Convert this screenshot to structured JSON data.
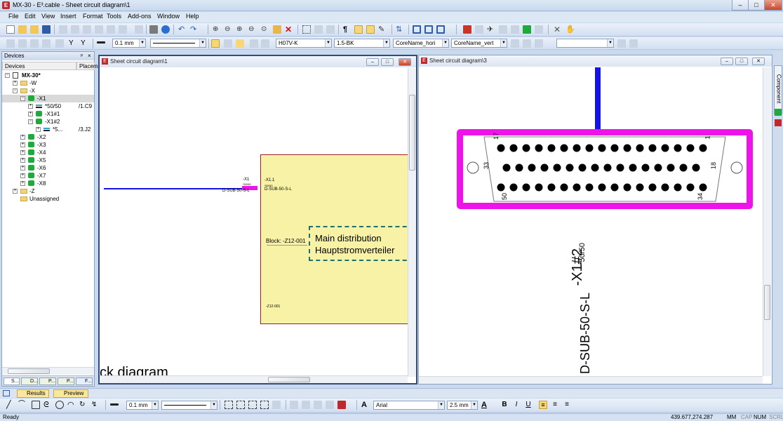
{
  "app": {
    "title": "MX-30 - E³.cable - Sheet circuit diagram\\1",
    "app_icon": "e3-icon",
    "window_buttons": [
      "–",
      "□",
      "✕"
    ]
  },
  "menu": [
    "File",
    "Edit",
    "View",
    "Insert",
    "Format",
    "Tools",
    "Add-ons",
    "Window",
    "Help"
  ],
  "toolbar2": {
    "line_width": "0.1 mm",
    "wire_type": "H07V-K",
    "wire_color": "1.5-BK",
    "core_name_h": "CoreName_hori",
    "core_name_v": "CoreName_vert"
  },
  "devices_panel": {
    "title": "Devices",
    "pin": "ᵖ",
    "close": "×",
    "columns": [
      "Devices",
      "Placem"
    ],
    "tree": [
      {
        "level": 0,
        "label": "MX-30*",
        "icon": "project",
        "exp": "−",
        "bold": true
      },
      {
        "level": 1,
        "label": "-W",
        "icon": "folder",
        "exp": "+"
      },
      {
        "level": 1,
        "label": "-X",
        "icon": "folder",
        "exp": "−"
      },
      {
        "level": 2,
        "label": "-X1",
        "icon": "device",
        "exp": "−",
        "selected": true
      },
      {
        "level": 3,
        "label": "*50/50",
        "icon": "wire",
        "exp": "+",
        "place": "/1.C9"
      },
      {
        "level": 3,
        "label": "-X1#1",
        "icon": "device",
        "exp": "+"
      },
      {
        "level": 3,
        "label": "-X1#2",
        "icon": "device",
        "exp": "−"
      },
      {
        "level": 4,
        "label": "*5...",
        "icon": "wire",
        "exp": "+",
        "place": "/3.J2"
      },
      {
        "level": 2,
        "label": "-X2",
        "icon": "device",
        "exp": "+"
      },
      {
        "level": 2,
        "label": "-X3",
        "icon": "device",
        "exp": "+"
      },
      {
        "level": 2,
        "label": "-X4",
        "icon": "device",
        "exp": "+"
      },
      {
        "level": 2,
        "label": "-X5",
        "icon": "device",
        "exp": "+"
      },
      {
        "level": 2,
        "label": "-X6",
        "icon": "device",
        "exp": "+"
      },
      {
        "level": 2,
        "label": "-X7",
        "icon": "device",
        "exp": "+"
      },
      {
        "level": 2,
        "label": "-X8",
        "icon": "device",
        "exp": "+"
      },
      {
        "level": 1,
        "label": "-Z",
        "icon": "folder",
        "exp": "+"
      },
      {
        "level": 1,
        "label": "Unassigned",
        "icon": "folder",
        "exp": ""
      }
    ],
    "bottom_tabs": [
      "S...",
      "D...",
      "P...",
      "P...",
      "F..."
    ]
  },
  "sheet1": {
    "title": "Sheet circuit diagram\\1",
    "connector_top": "-X1",
    "connector_pin": "*50/50",
    "connector_part": "D-SUB-50-S-L",
    "connector2_top": "-X1.1",
    "connector2_pin": "*50/50",
    "connector2_part": "D-SUB-50-S-L",
    "block_label": "Block: -Z12-001",
    "block_line1": "Main distribution",
    "block_line2": "Hauptstromverteiler",
    "block_small": "-Z12-001",
    "partial_text": "ck diagram"
  },
  "sheet3": {
    "title": "Sheet circuit diagram\\3",
    "pin_17": "17",
    "pin_1": "1",
    "pin_33": "33",
    "pin_18": "18",
    "pin_50": "50",
    "pin_34": "34",
    "device_name": "-X1#2",
    "device_pin": "*50/50",
    "device_part": "D-SUB-50-S-L",
    "colors": {
      "highlight": "#ee13e8",
      "wire": "#1414e6"
    }
  },
  "right_sidebar": {
    "label": "Component"
  },
  "results_bar": {
    "results": "Results",
    "preview": "Preview"
  },
  "bottom_toolbar": {
    "line_width": "0.1 mm",
    "font": "Arial",
    "font_size": "2.5 mm",
    "bold": "B",
    "italic": "I",
    "underline": "U"
  },
  "status": {
    "text": "Ready",
    "coords": "439.677,274.287",
    "indicators": [
      "MM",
      "CAP",
      "NUM",
      "SCRL"
    ]
  }
}
